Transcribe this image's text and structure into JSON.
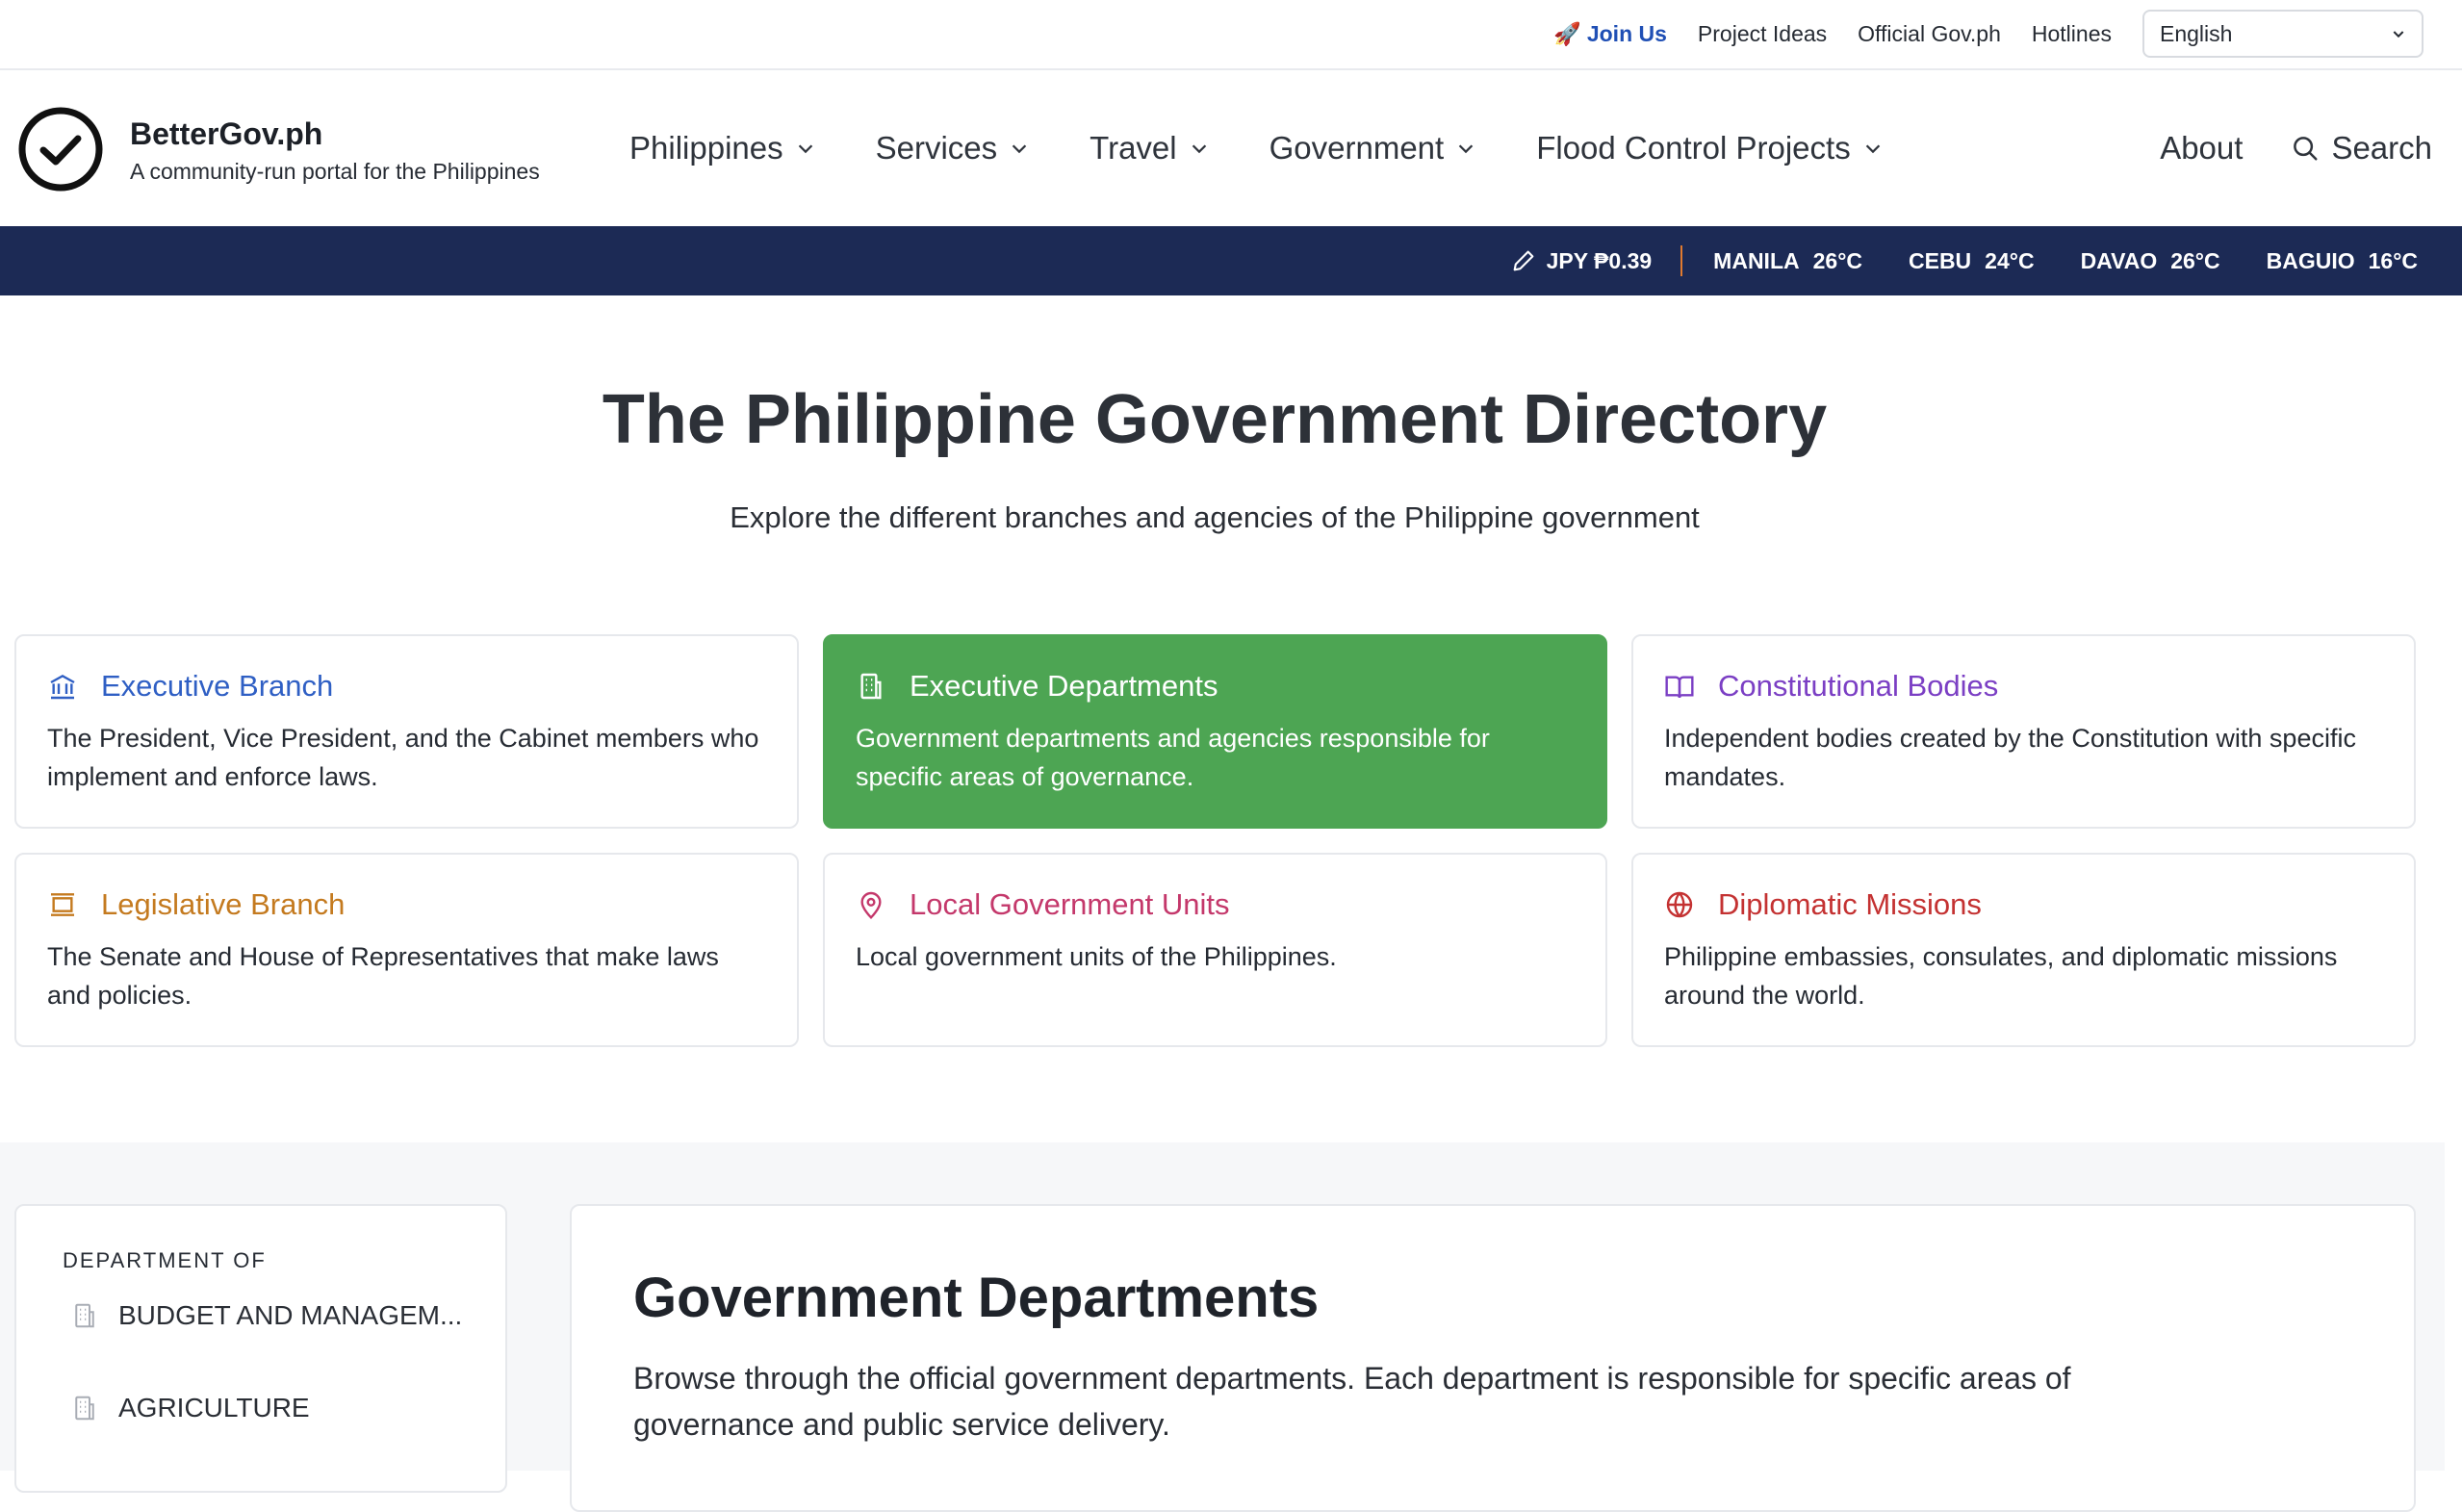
{
  "util": {
    "join": "Join Us",
    "links": [
      "Project Ideas",
      "Official Gov.ph",
      "Hotlines"
    ],
    "language": "English"
  },
  "brand": {
    "name": "BetterGov.ph",
    "tagline": "A community-run portal for the Philippines"
  },
  "nav": {
    "items": [
      "Philippines",
      "Services",
      "Travel",
      "Government",
      "Flood Control Projects"
    ],
    "about": "About",
    "search": "Search"
  },
  "ticker": {
    "fx": "JPY ₱0.39",
    "weather": [
      {
        "city": "MANILA",
        "temp": "26°C"
      },
      {
        "city": "CEBU",
        "temp": "24°C"
      },
      {
        "city": "DAVAO",
        "temp": "26°C"
      },
      {
        "city": "BAGUIO",
        "temp": "16°C"
      }
    ]
  },
  "hero": {
    "title": "The Philippine Government Directory",
    "subtitle": "Explore the different branches and agencies of the Philippine government"
  },
  "cards": [
    {
      "title": "Executive Branch",
      "desc": "The President, Vice President, and the Cabinet members who implement and enforce laws.",
      "color": "#2f5fc4",
      "icon": "landmark-icon"
    },
    {
      "title": "Executive Departments",
      "desc": "Government departments and agencies responsible for specific areas of governance.",
      "color": "#ffffff",
      "icon": "building-icon"
    },
    {
      "title": "Constitutional Bodies",
      "desc": "Independent bodies created by the Constitution with specific mandates.",
      "color": "#7b3fc4",
      "icon": "book-open-icon"
    },
    {
      "title": "Legislative Branch",
      "desc": "The Senate and House of Representatives that make laws and policies.",
      "color": "#c47a1f",
      "icon": "gavel-box-icon"
    },
    {
      "title": "Local Government Units",
      "desc": "Local government units of the Philippines.",
      "color": "#c4386b",
      "icon": "map-pin-icon"
    },
    {
      "title": "Diplomatic Missions",
      "desc": "Philippine embassies, consulates, and diplomatic missions around the world.",
      "color": "#c43232",
      "icon": "globe-icon"
    }
  ],
  "sidebar": {
    "heading": "DEPARTMENT OF",
    "items": [
      "BUDGET AND MANAGEM...",
      "AGRICULTURE"
    ]
  },
  "main": {
    "title": "Government Departments",
    "desc": "Browse through the official government departments. Each department is responsible for specific areas of governance and public service delivery."
  },
  "colors": {
    "ticker_bg": "#1c2a55",
    "active_card": "#4da553",
    "join_link": "#1f4fb5"
  }
}
